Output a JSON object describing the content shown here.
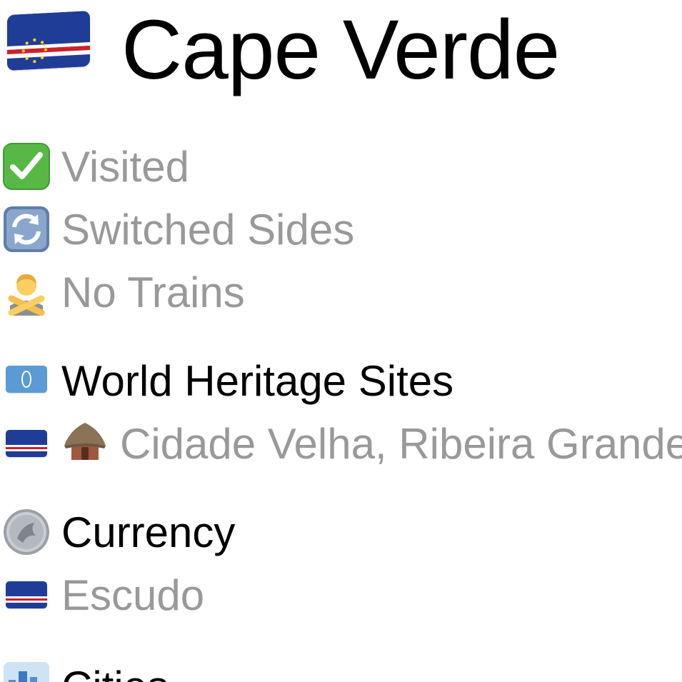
{
  "title": {
    "flag_icon": "cape-verde-flag-icon",
    "text": "Cape Verde"
  },
  "status": {
    "visited": {
      "icon": "check-mark-button-icon",
      "label": "Visited"
    },
    "switched_sides": {
      "icon": "counterclockwise-arrows-icon",
      "label": "Switched Sides"
    },
    "no_trains": {
      "icon": "person-gesturing-no-icon",
      "label": "No Trains"
    }
  },
  "world_heritage": {
    "icon": "united-nations-flag-icon",
    "heading": "World Heritage Sites",
    "items": [
      {
        "flag_icon": "cape-verde-flag-icon",
        "type_icon": "hut-icon",
        "label": "Cidade Velha, Ribeira Grande"
      }
    ]
  },
  "currency": {
    "icon": "coin-icon",
    "heading": "Currency",
    "items": [
      {
        "flag_icon": "cape-verde-flag-icon",
        "label": "Escudo"
      }
    ]
  },
  "cities": {
    "icon": "cityscape-icon",
    "heading": "Cities"
  },
  "colors": {
    "muted_text": "#999999",
    "heading_text": "#000000",
    "cv_blue": "#1f3c97",
    "cv_red": "#cf2027",
    "cv_yellow": "#f7d116",
    "check_green": "#57b846",
    "sync_blue": "#5f7ea8"
  }
}
